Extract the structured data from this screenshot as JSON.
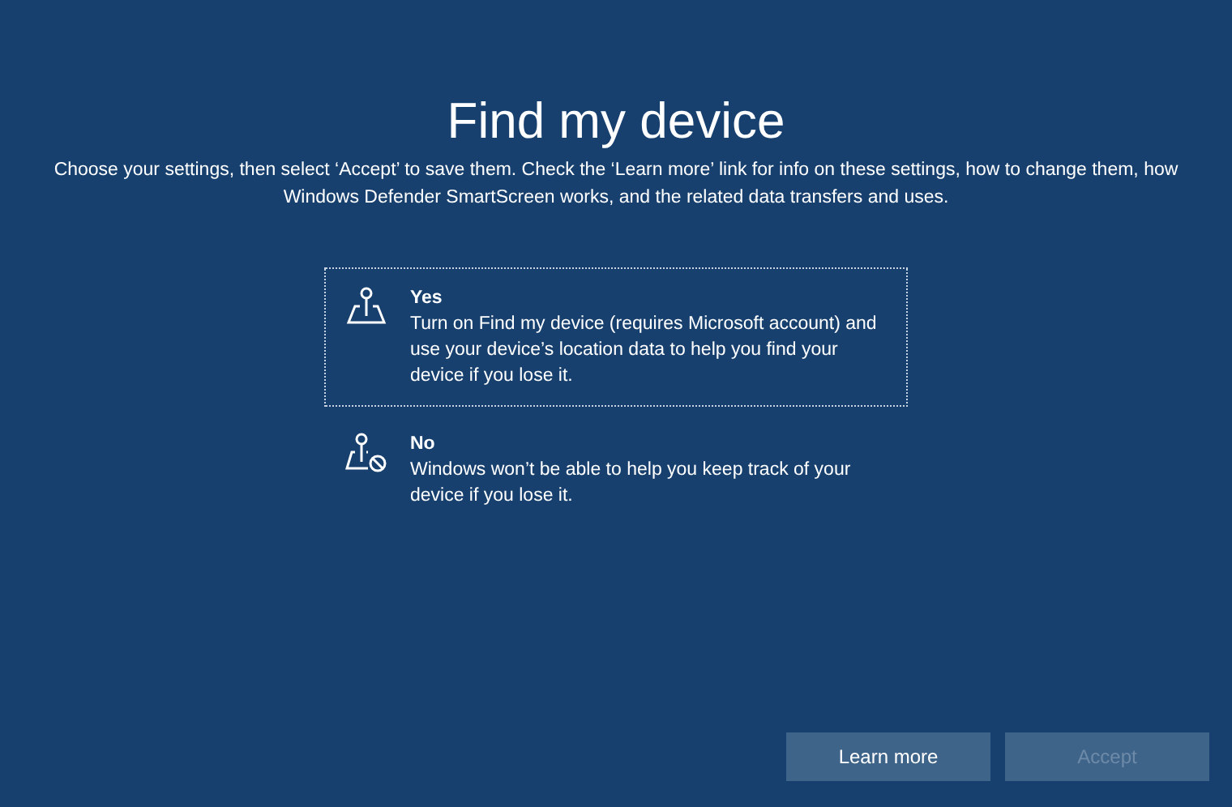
{
  "title": "Find my device",
  "subtitle": "Choose your settings, then select ‘Accept’ to save them. Check the ‘Learn more’ link for info on these settings, how to change them, how Windows Defender SmartScreen works, and the related data transfers and uses.",
  "options": [
    {
      "kind": "location",
      "label": "Yes",
      "description": "Turn on Find my device (requires Microsoft account) and use your device’s location data to help you find your device if you lose it.",
      "selected": true
    },
    {
      "kind": "location-blocked",
      "label": "No",
      "description": "Windows won’t be able to help you keep track of your device if you lose it.",
      "selected": false
    }
  ],
  "buttons": [
    {
      "label": "Learn more",
      "disabled": false
    },
    {
      "label": "Accept",
      "disabled": true
    }
  ]
}
